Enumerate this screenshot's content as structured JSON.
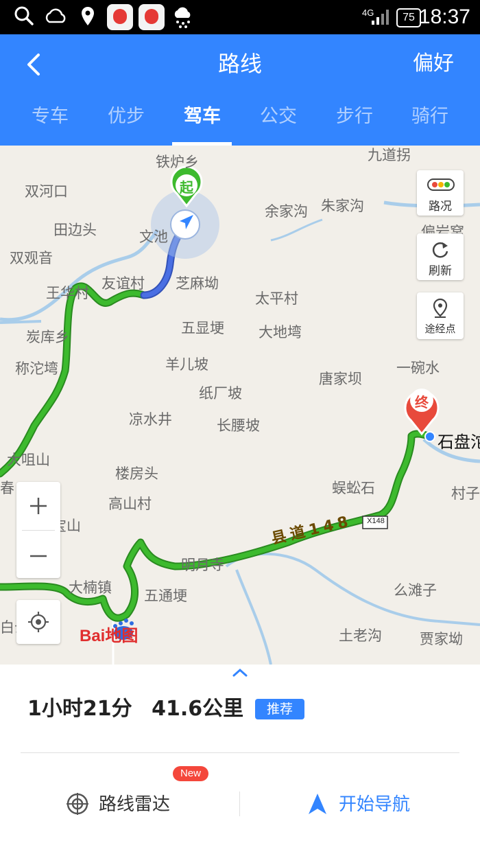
{
  "status_bar": {
    "time": "18:37",
    "battery": "75",
    "network": "4G",
    "icons": [
      "search-icon",
      "cloud-icon",
      "location-icon",
      "baidu-map-app-icon",
      "baidu-map-app-icon",
      "snow-weather-icon",
      "signal-icon",
      "battery-icon"
    ]
  },
  "header": {
    "title": "路线",
    "preference": "偏好",
    "tabs": [
      "专车",
      "优步",
      "驾车",
      "公交",
      "步行",
      "骑行"
    ],
    "active_tab": "驾车",
    "accent_color": "#3385ff"
  },
  "map": {
    "places": [
      "铁炉乡",
      "九道拐",
      "双河口",
      "余家沟",
      "朱家沟",
      "田边头",
      "文池",
      "偏岩窝",
      "双观音",
      "友谊村",
      "芝麻坳",
      "王华村",
      "太平村",
      "五显埂",
      "大地塆",
      "炭库乡",
      "羊儿坡",
      "称沱塆",
      "唐家坝",
      "一碗水",
      "纸厂坡",
      "凉水井",
      "长腰坡",
      "大咀山",
      "楼房头",
      "蜈蚣石",
      "村子",
      "春",
      "高山村",
      "宝山",
      "明月寺",
      "么滩子",
      "大楠镇",
      "五通埂",
      "白云",
      "土老沟",
      "贾家坳"
    ],
    "destination_label": "石盘沱",
    "road_label": "县道148",
    "road_shield": "X148",
    "start_marker": "起",
    "end_marker": "终",
    "logo": "Bai地图",
    "controls": {
      "traffic": "路况",
      "refresh": "刷新",
      "waypoint": "途经点"
    },
    "route_color": "#3dba2e",
    "walked_color": "#4a6fe3"
  },
  "route": {
    "duration": "1小时21分",
    "distance": "41.6公里",
    "tag": "推荐"
  },
  "actions": {
    "radar_label": "路线雷达",
    "new_badge": "New",
    "navigate_label": "开始导航"
  }
}
